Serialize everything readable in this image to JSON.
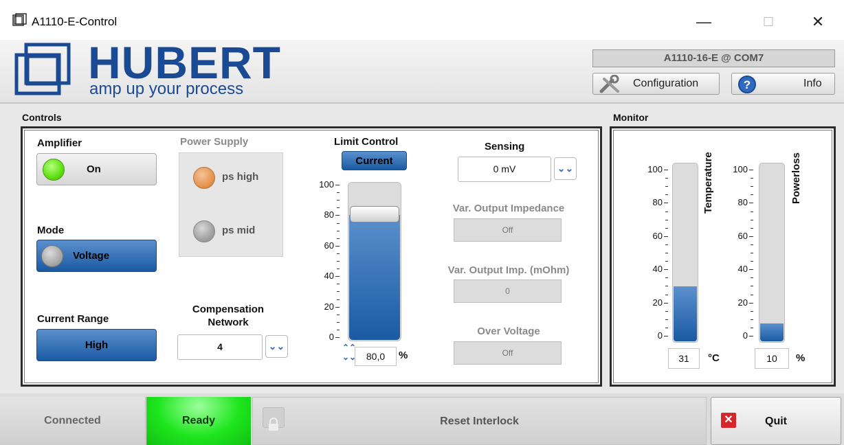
{
  "window": {
    "title": "A1110-E-Control",
    "minimize": "—",
    "maximize": "☐",
    "close": "✕"
  },
  "header": {
    "brand": "HUBERT",
    "tagline": "amp up your process",
    "device": "A1110-16-E @ COM7",
    "configuration_label": "Configuration",
    "info_label": "Info"
  },
  "controls": {
    "section_title": "Controls",
    "amplifier": {
      "label": "Amplifier",
      "button": "On",
      "led_color": "#5ee012"
    },
    "power_supply": {
      "label": "Power Supply",
      "ps_high": {
        "label": "ps high",
        "led_color": "#e69552"
      },
      "ps_mid": {
        "label": "ps mid",
        "led_color": "#a2a2a2"
      }
    },
    "mode": {
      "label": "Mode",
      "button": "Voltage",
      "led_color": "#a9a9a9"
    },
    "current_range": {
      "label": "Current Range",
      "button": "High"
    },
    "compensation": {
      "label_line1": "Compensation",
      "label_line2": "Network",
      "value": "4",
      "arrow": "⌄⌄"
    },
    "limit_control": {
      "label": "Limit Control",
      "mode_button": "Current",
      "ticks": [
        "100",
        "80",
        "60",
        "40",
        "20",
        "0"
      ],
      "value_percent": 80,
      "value_text": "80,0",
      "unit": "%",
      "stepper_up": "⌃⌃",
      "stepper_down": "⌄⌄"
    },
    "sensing": {
      "label": "Sensing",
      "value": "0 mV",
      "arrow": "⌄⌄"
    },
    "var_output_impedance": {
      "label": "Var. Output Impedance",
      "value": "Off"
    },
    "var_output_imp_mohm": {
      "label": "Var. Output Imp. (mOhm)",
      "value": "0"
    },
    "over_voltage": {
      "label": "Over Voltage",
      "value": "Off"
    }
  },
  "monitor": {
    "section_title": "Monitor",
    "temperature": {
      "label": "Temperature",
      "ticks": [
        "100",
        "80",
        "60",
        "40",
        "20",
        "0"
      ],
      "value_percent": 31,
      "value_text": "31",
      "unit": "°C"
    },
    "powerloss": {
      "label": "Powerloss",
      "ticks": [
        "100",
        "80",
        "60",
        "40",
        "20",
        "0"
      ],
      "value_percent": 10,
      "value_text": "10",
      "unit": "%"
    }
  },
  "status_bar": {
    "connected": "Connected",
    "ready": "Ready",
    "reset_interlock": "Reset Interlock",
    "quit": "Quit"
  },
  "colors": {
    "brand_blue": "#1b4a94",
    "accent_blue": "#1a5aa2",
    "ready_green": "#1ee61e",
    "quit_red": "#d7262a"
  }
}
